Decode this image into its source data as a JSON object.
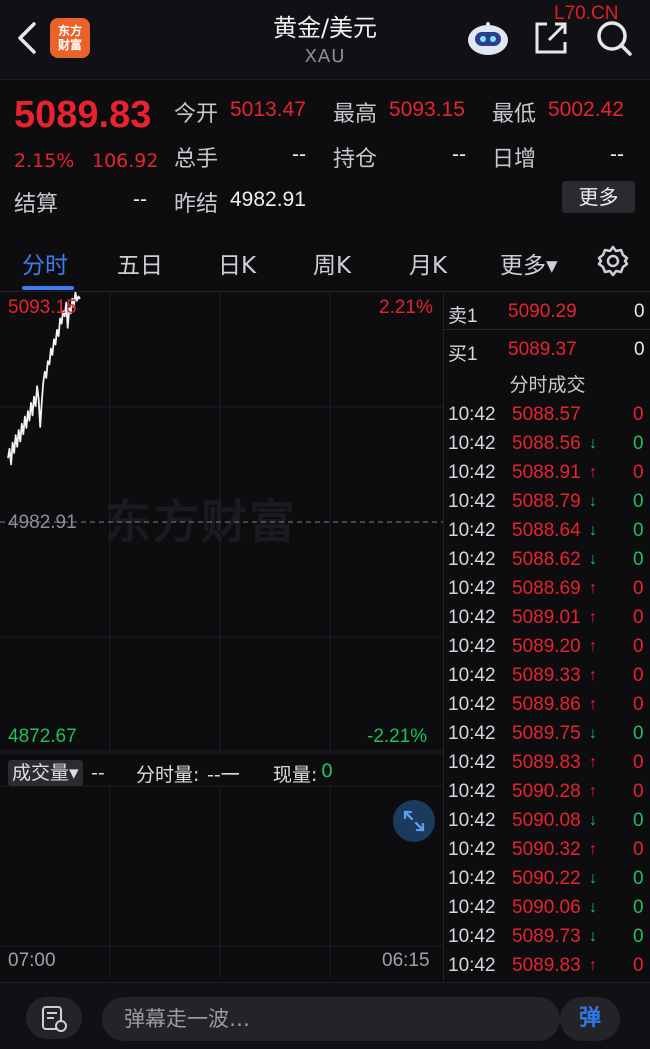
{
  "header": {
    "title": "黄金/美元",
    "subtitle": "XAU",
    "logo_line1": "东方",
    "logo_line2": "财富",
    "watermark": "L70.CN"
  },
  "quote": {
    "price": "5089.83",
    "change_pct": "2.15%",
    "change": "106.92",
    "open_label": "今开",
    "open": "5013.47",
    "high_label": "最高",
    "high": "5093.15",
    "low_label": "最低",
    "low": "5002.42",
    "volume_label": "总手",
    "volume": "--",
    "position_label": "持仓",
    "position": "--",
    "daily_inc_label": "日增",
    "daily_inc": "--",
    "settle_label": "结算",
    "settle": "--",
    "prev_close_label": "昨结",
    "prev_close": "4982.91",
    "more_button": "更多"
  },
  "tabs": [
    "分时",
    "五日",
    "日K",
    "周K",
    "月K",
    "更多▾"
  ],
  "active_tab": 0,
  "chart": {
    "top_price": "5093.15",
    "top_pct": "2.21%",
    "mid_price": "4982.91",
    "bottom_price": "4872.67",
    "bottom_pct": "-2.21%",
    "watermark": "东方财富",
    "x_start": "07:00",
    "x_end": "06:15",
    "vol_dropdown": "成交量▾",
    "vol_value": "--",
    "period_vol_label": "分时量:",
    "period_vol_value": "--一",
    "cur_vol_label": "现量:",
    "cur_vol_value": "0"
  },
  "chart_data": {
    "type": "line",
    "ylim": [
      4872.67,
      5093.15
    ],
    "reference": 4982.91,
    "values": [
      5013.47,
      5018.0,
      5010.5,
      5021.0,
      5016.0,
      5024.5,
      5019.0,
      5027.0,
      5021.5,
      5030.0,
      5025.0,
      5033.5,
      5028.0,
      5036.0,
      5031.5,
      5040.0,
      5034.0,
      5043.0,
      5038.5,
      5048.0,
      5042.0,
      5028.5,
      5040.0,
      5049.5,
      5055.0,
      5052.0,
      5060.0,
      5058.5,
      5066.0,
      5063.0,
      5070.5,
      5068.0,
      5075.0,
      5072.0,
      5080.5,
      5078.0,
      5084.0,
      5081.5,
      5088.0,
      5076.0,
      5085.5,
      5083.0,
      5090.0,
      5086.0,
      5093.15,
      5089.0,
      5091.0,
      5089.83
    ]
  },
  "order_book": [
    {
      "label": "卖1",
      "price": "5090.29",
      "vol": "0"
    },
    {
      "label": "买1",
      "price": "5089.37",
      "vol": "0"
    }
  ],
  "ticks_header": "分时成交",
  "ticks": [
    {
      "time": "10:42",
      "price": "5088.57",
      "dir": "",
      "vol": "0",
      "vol_color": "red"
    },
    {
      "time": "10:42",
      "price": "5088.56",
      "dir": "↓",
      "vol": "0",
      "vol_color": "green"
    },
    {
      "time": "10:42",
      "price": "5088.91",
      "dir": "↑",
      "vol": "0",
      "vol_color": "red"
    },
    {
      "time": "10:42",
      "price": "5088.79",
      "dir": "↓",
      "vol": "0",
      "vol_color": "green"
    },
    {
      "time": "10:42",
      "price": "5088.64",
      "dir": "↓",
      "vol": "0",
      "vol_color": "green"
    },
    {
      "time": "10:42",
      "price": "5088.62",
      "dir": "↓",
      "vol": "0",
      "vol_color": "green"
    },
    {
      "time": "10:42",
      "price": "5088.69",
      "dir": "↑",
      "vol": "0",
      "vol_color": "red"
    },
    {
      "time": "10:42",
      "price": "5089.01",
      "dir": "↑",
      "vol": "0",
      "vol_color": "red"
    },
    {
      "time": "10:42",
      "price": "5089.20",
      "dir": "↑",
      "vol": "0",
      "vol_color": "red"
    },
    {
      "time": "10:42",
      "price": "5089.33",
      "dir": "↑",
      "vol": "0",
      "vol_color": "red"
    },
    {
      "time": "10:42",
      "price": "5089.86",
      "dir": "↑",
      "vol": "0",
      "vol_color": "red"
    },
    {
      "time": "10:42",
      "price": "5089.75",
      "dir": "↓",
      "vol": "0",
      "vol_color": "green"
    },
    {
      "time": "10:42",
      "price": "5089.83",
      "dir": "↑",
      "vol": "0",
      "vol_color": "red"
    },
    {
      "time": "10:42",
      "price": "5090.28",
      "dir": "↑",
      "vol": "0",
      "vol_color": "red"
    },
    {
      "time": "10:42",
      "price": "5090.08",
      "dir": "↓",
      "vol": "0",
      "vol_color": "green"
    },
    {
      "time": "10:42",
      "price": "5090.32",
      "dir": "↑",
      "vol": "0",
      "vol_color": "red"
    },
    {
      "time": "10:42",
      "price": "5090.22",
      "dir": "↓",
      "vol": "0",
      "vol_color": "green"
    },
    {
      "time": "10:42",
      "price": "5090.06",
      "dir": "↓",
      "vol": "0",
      "vol_color": "green"
    },
    {
      "time": "10:42",
      "price": "5089.73",
      "dir": "↓",
      "vol": "0",
      "vol_color": "green"
    },
    {
      "time": "10:42",
      "price": "5089.83",
      "dir": "↑",
      "vol": "0",
      "vol_color": "red"
    }
  ],
  "bottom": {
    "danmu_placeholder": "弹幕走一波…",
    "danmu_button": "弹"
  },
  "colors": {
    "up": "#e8232f",
    "down": "#1fc05a",
    "accent": "#3c7cf0",
    "brand": "#e9622a"
  }
}
